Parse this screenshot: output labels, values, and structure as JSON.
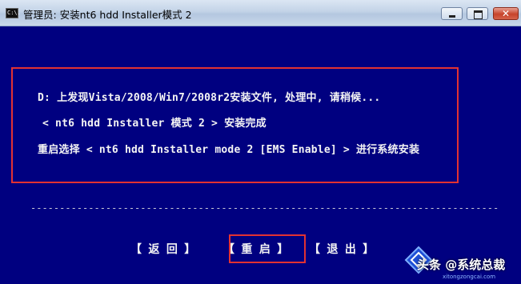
{
  "window": {
    "title": "管理员:  安装nt6 hdd Installer模式 2",
    "icon": "console-icon",
    "icon_text": "C:\\.",
    "buttons": {
      "minimize": "minimize-icon",
      "maximize": "maximize-icon",
      "close": "close-icon",
      "close_glyph": "✕"
    }
  },
  "console": {
    "lines": [
      "D: 上发现Vista/2008/Win7/2008r2安装文件, 处理中, 请稍候...",
      "< nt6 hdd Installer 模式 2 > 安装完成",
      "重启选择 < nt6 hdd Installer mode 2 [EMS Enable] > 进行系统安装"
    ],
    "divider": "-------------------------------------------------------------------------------------------------"
  },
  "menu": {
    "back": "【 返 回 】",
    "restart": "【 重 启 】",
    "exit": "【 退 出 】"
  },
  "annotations": {
    "highlight_color": "#e23232"
  },
  "watermark": {
    "text": "头条 @系统总裁",
    "sub": "xitongzongcai.com"
  }
}
